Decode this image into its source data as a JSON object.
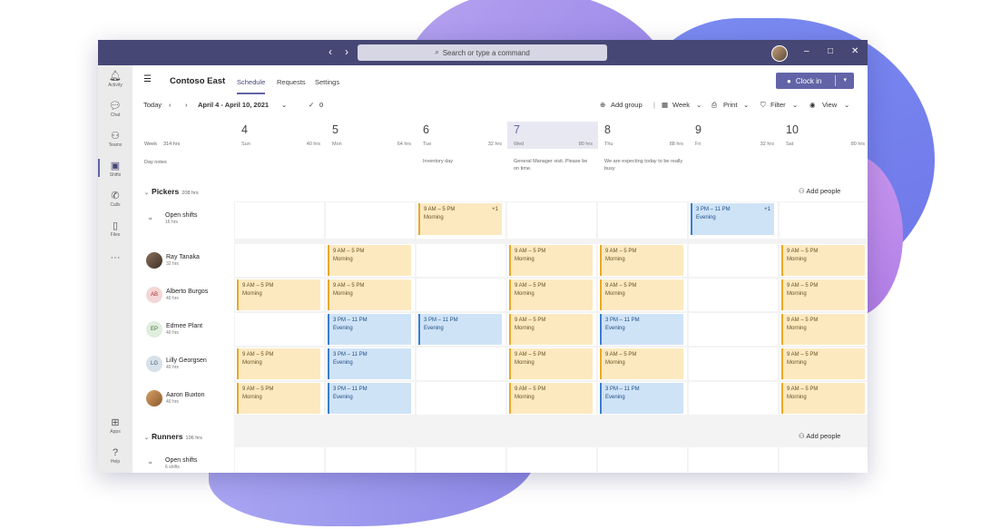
{
  "titlebar": {
    "search_placeholder": "Search or type a command"
  },
  "rail": [
    {
      "icon": "bell-icon",
      "label": "Activity"
    },
    {
      "icon": "chat-icon",
      "label": "Chat"
    },
    {
      "icon": "teams-icon",
      "label": "Teams"
    },
    {
      "icon": "shifts-icon",
      "label": "Shifts",
      "active": true
    },
    {
      "icon": "calls-icon",
      "label": "Calls"
    },
    {
      "icon": "files-icon",
      "label": "Files"
    },
    {
      "icon": "more-icon",
      "label": "..."
    },
    {
      "icon": "apps-icon",
      "label": "Apps"
    },
    {
      "icon": "help-icon",
      "label": "Help"
    }
  ],
  "app": {
    "title": "Contoso East",
    "tabs": [
      "Schedule",
      "Requests",
      "Settings"
    ],
    "clock_in": "Clock in"
  },
  "toolbar": {
    "today": "Today",
    "date_range": "April 4 - April 10, 2021",
    "check_count": "0",
    "add_group": "Add group",
    "week": "Week",
    "print": "Print",
    "filter": "Filter",
    "view": "View"
  },
  "week": {
    "label": "Week",
    "hours": "314 hrs",
    "day_notes_label": "Day notes"
  },
  "days": [
    {
      "num": "4",
      "name": "Sun",
      "hrs": "40 hrs",
      "note": ""
    },
    {
      "num": "5",
      "name": "Mon",
      "hrs": "64 hrs",
      "note": ""
    },
    {
      "num": "6",
      "name": "Tue",
      "hrs": "32 hrs",
      "note": "Inventory day"
    },
    {
      "num": "7",
      "name": "Wed",
      "hrs": "80 hrs",
      "note": "General Manager visit. Please be on time.",
      "today": true
    },
    {
      "num": "8",
      "name": "Thu",
      "hrs": "88 hrs",
      "note": "We are expecting today to be really busy"
    },
    {
      "num": "9",
      "name": "Fri",
      "hrs": "32 hrs",
      "note": ""
    },
    {
      "num": "10",
      "name": "Sat",
      "hrs": "80 hrs",
      "note": ""
    }
  ],
  "groups": {
    "pickers": {
      "name": "Pickers",
      "hours": "208 hrs",
      "add_people": "Add people"
    },
    "runners": {
      "name": "Runners",
      "hours": "106 hrs",
      "add_people": "Add people"
    }
  },
  "open_shifts": {
    "label": "Open shifts",
    "pickers_hrs": "16 hrs",
    "runners_hrs": "6 shifts"
  },
  "shift_types": {
    "morning": {
      "time": "9 AM – 5 PM",
      "label": "Morning"
    },
    "evening": {
      "time": "3 PM – 11 PM",
      "label": "Evening"
    }
  },
  "open_shift_badge": "+1",
  "people": [
    {
      "name": "Ray Tanaka",
      "hrs": "32 hrs",
      "initials": "",
      "shifts": [
        "",
        "m",
        "",
        "m",
        "m",
        "",
        "m"
      ]
    },
    {
      "name": "Alberto Burgos",
      "hrs": "40 hrs",
      "initials": "AB",
      "shifts": [
        "m",
        "m",
        "",
        "m",
        "m",
        "",
        "m"
      ]
    },
    {
      "name": "Edmee Plant",
      "hrs": "40 hrs",
      "initials": "EP",
      "shifts": [
        "",
        "e",
        "e",
        "m",
        "e",
        "",
        "m"
      ]
    },
    {
      "name": "Lilly Georgsen",
      "hrs": "40 hrs",
      "initials": "LG",
      "shifts": [
        "m",
        "e",
        "",
        "m",
        "m",
        "",
        "m"
      ]
    },
    {
      "name": "Aaron Buxton",
      "hrs": "40 hrs",
      "initials": "",
      "shifts": [
        "m",
        "e",
        "",
        "m",
        "e",
        "",
        "m"
      ]
    }
  ],
  "colors": {
    "brand": "#6264a7",
    "titlebar": "#464775",
    "morning": "#fce9c0",
    "evening": "#cfe3f7"
  }
}
